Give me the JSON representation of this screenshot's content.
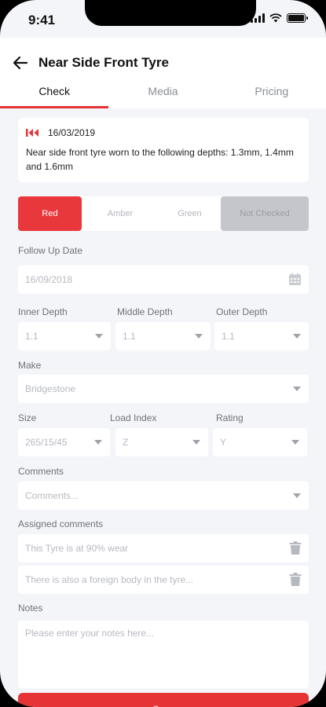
{
  "status_bar": {
    "time": "9:41"
  },
  "header": {
    "title": "Near Side Front Tyre"
  },
  "tabs": [
    {
      "label": "Check",
      "active": true
    },
    {
      "label": "Media",
      "active": false
    },
    {
      "label": "Pricing",
      "active": false
    }
  ],
  "history": {
    "date": "16/03/2019",
    "description": "Near side front tyre worn to the following depths: 1.3mm, 1.4mm and 1.6mm"
  },
  "condition": {
    "options": [
      "Red",
      "Amber",
      "Green",
      "Not Checked"
    ],
    "selected": "Red"
  },
  "follow_up": {
    "label": "Follow Up Date",
    "value": "16/09/2018"
  },
  "depths": {
    "inner_label": "Inner Depth",
    "inner_value": "1.1",
    "middle_label": "Middle Depth",
    "middle_value": "1.1",
    "outer_label": "Outer Depth",
    "outer_value": "1.1"
  },
  "make": {
    "label": "Make",
    "value": "Bridgestone"
  },
  "size": {
    "label": "Size",
    "value": "265/15/45"
  },
  "load_index": {
    "label": "Load Index",
    "value": "Z"
  },
  "rating": {
    "label": "Rating",
    "value": "Y"
  },
  "comments": {
    "label": "Comments",
    "placeholder": "Comments..."
  },
  "assigned": {
    "label": "Assigned comments",
    "items": [
      "This Tyre is at 90% wear",
      "There is also a foreign body in the tyre..."
    ]
  },
  "notes": {
    "label": "Notes",
    "placeholder": "Please enter your notes here..."
  },
  "save_label": "Save",
  "colors": {
    "accent": "#e63335",
    "background": "#f4f5f9",
    "not_checked": "#c4c6cc"
  }
}
